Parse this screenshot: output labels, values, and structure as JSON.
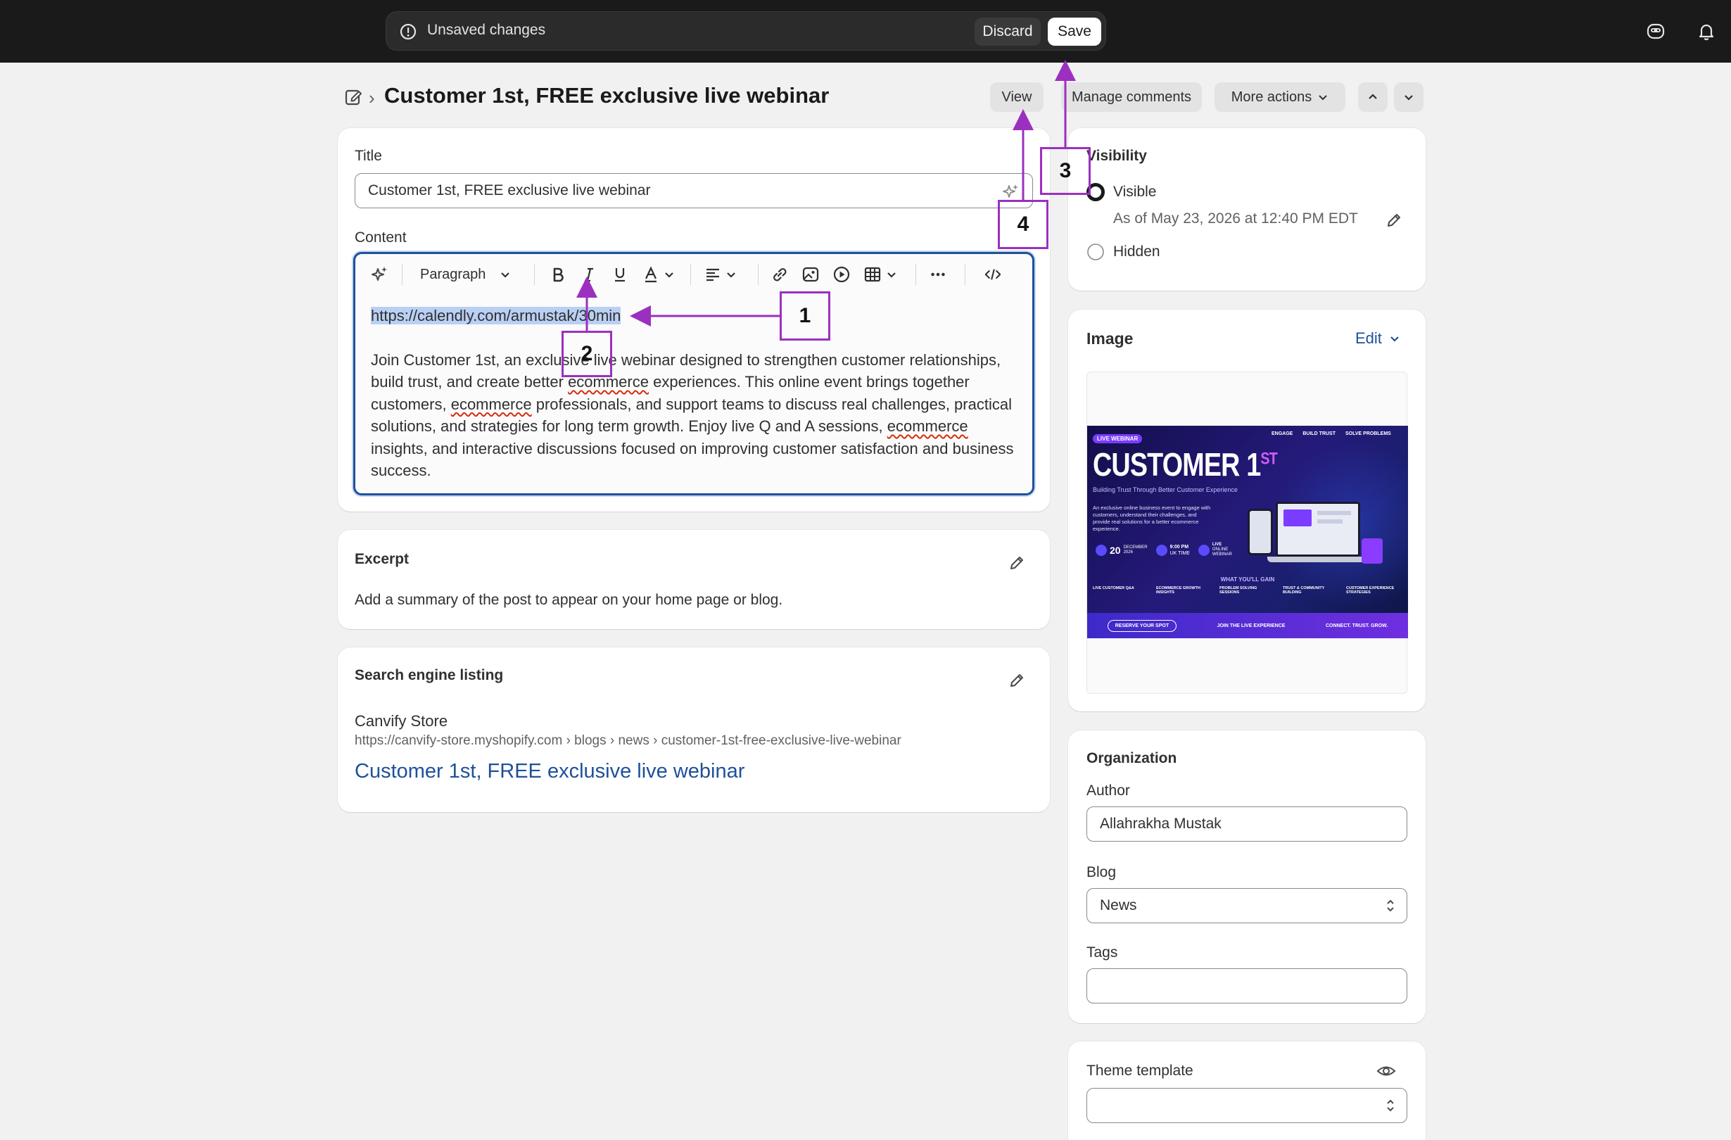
{
  "savebar": {
    "status": "Unsaved changes",
    "discard": "Discard",
    "save": "Save"
  },
  "header": {
    "title": "Customer 1st, FREE exclusive live webinar",
    "view": "View",
    "manage_comments": "Manage comments",
    "more_actions": "More actions"
  },
  "main": {
    "title_label": "Title",
    "title_value": "Customer 1st, FREE exclusive live webinar",
    "content_label": "Content",
    "toolbar": {
      "paragraph": "Paragraph"
    },
    "content": {
      "link": "https://calendly.com/armustak/30min",
      "p_part1": "Join Customer 1st, an exclusive live webinar designed to strengthen customer relationships, build trust, and create better ",
      "word_ecommerce": "ecommerce",
      "p_part2": " experiences. This online event brings together customers, ",
      "p_part3": " professionals, and support teams to discuss real challenges, practical solutions, and strategies for long term growth. Enjoy live Q and A sessions, ",
      "p_part4": " insights, and interactive discussions focused on improving customer satisfaction and business success."
    }
  },
  "excerpt": {
    "title": "Excerpt",
    "text": "Add a summary of the post to appear on your home page or blog."
  },
  "seo": {
    "title": "Search engine listing",
    "store": "Canvify Store",
    "url": "https://canvify-store.myshopify.com › blogs › news › customer-1st-free-exclusive-live-webinar",
    "link_title": "Customer 1st, FREE exclusive live webinar"
  },
  "visibility": {
    "title": "Visibility",
    "visible": "Visible",
    "as_of": "As of May 23, 2026 at 12:40 PM EDT",
    "hidden": "Hidden",
    "selected": "Visible"
  },
  "image": {
    "title": "Image",
    "edit": "Edit",
    "banner": {
      "tag": "LIVE WEBINAR",
      "headline": "CUSTOMER 1",
      "headline_sup": "ST",
      "subhead": "Building Trust Through Better Customer Experience",
      "desc": "An exclusive online business event to engage with customers, understand their challenges, and provide real solutions for a better ecommerce experience.",
      "date_day": "20",
      "date_month": "DECEMBER",
      "date_year": "2026",
      "time": "9:00 PM",
      "time_zone": "UK TIME",
      "live": "LIVE",
      "online": "ONLINE",
      "webinar": "WEBINAR",
      "pillars": [
        "ENGAGE",
        "BUILD TRUST",
        "SOLVE PROBLEMS"
      ],
      "gain_title": "WHAT YOU'LL GAIN",
      "gains": [
        "LIVE CUSTOMER Q&A",
        "ECOMMERCE GROWTH INSIGHTS",
        "PROBLEM SOLVING SESSIONS",
        "TRUST & COMMUNITY BUILDING",
        "CUSTOMER EXPERIENCE STRATEGIES"
      ],
      "cta": "RESERVE YOUR SPOT",
      "cta2": "JOIN THE LIVE EXPERIENCE",
      "cta3": "CONNECT. TRUST. GROW."
    }
  },
  "organization": {
    "title": "Organization",
    "author_label": "Author",
    "author": "Allahrakha Mustak",
    "blog_label": "Blog",
    "blog": "News",
    "tags_label": "Tags",
    "tags": ""
  },
  "theme": {
    "title": "Theme template",
    "value": ""
  },
  "annotations": [
    "1",
    "2",
    "3",
    "4"
  ],
  "colors": {
    "accent": "#9b30c0",
    "link": "#1f5199",
    "topbar": "#1a1a1a"
  }
}
